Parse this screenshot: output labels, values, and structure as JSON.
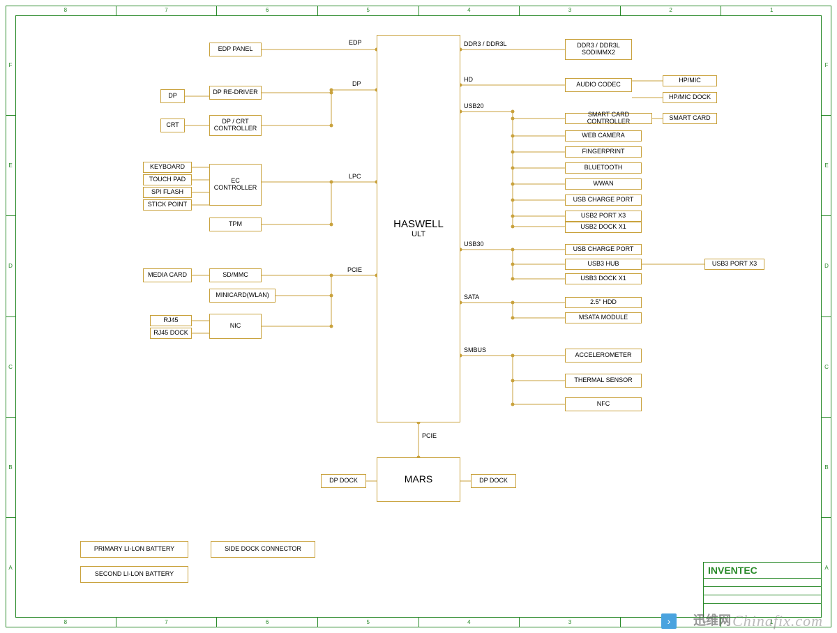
{
  "center": {
    "main": "HASWELL",
    "sub": "ULT",
    "south": "MARS"
  },
  "left_inputs": {
    "edp_panel": "EDP PANEL",
    "dp": "DP",
    "dp_redriver": "DP RE-DRIVER",
    "crt": "CRT",
    "dp_crt_ctrl": "DP / CRT\nCONTROLLER",
    "keyboard": "KEYBOARD",
    "touchpad": "TOUCH PAD",
    "spiflash": "SPI FLASH",
    "stickpoint": "STICK POINT",
    "ec": "EC\nCONTROLLER",
    "tpm": "TPM",
    "mediacard": "MEDIA CARD",
    "sdmmc": "SD/MMC",
    "minicard": "MINICARD(WLAN)",
    "rj45": "RJ45",
    "rj45dock": "RJ45 DOCK",
    "nic": "NIC"
  },
  "bus_labels": {
    "edp": "EDP",
    "dp": "DP",
    "lpc": "LPC",
    "pcie_left": "PCIE",
    "ddr": "DDR3 / DDR3L",
    "hd": "HD",
    "usb20": "USB20",
    "usb30": "USB30",
    "sata": "SATA",
    "smbus": "SMBUS",
    "pcie_down": "PCIE"
  },
  "right": {
    "ddr": "DDR3 / DDR3L\nSODIMMX2",
    "audio": "AUDIO CODEC",
    "hpmic": "HP/MIC",
    "hpmicdock": "HP/MIC DOCK",
    "smartctrl": "SMART CARD CONTROLLER",
    "smartcard": "SMART CARD",
    "webcam": "WEB CAMERA",
    "fingerprint": "FINGERPRINT",
    "bluetooth": "BLUETOOTH",
    "wwan": "WWAN",
    "usbcharge2": "USB CHARGE PORT",
    "usb2x3": "USB2 PORT X3",
    "usb2dock": "USB2 DOCK X1",
    "usbcharge3": "USB CHARGE PORT",
    "usb3hub": "USB3 HUB",
    "usb3dock": "USB3 DOCK X1",
    "usb3x3": "USB3 PORT X3",
    "hdd": "2.5\" HDD",
    "msata": "MSATA MODULE",
    "accel": "ACCELEROMETER",
    "thermal": "THERMAL SENSOR",
    "nfc": "NFC"
  },
  "south": {
    "dpdock_l": "DP DOCK",
    "dpdock_r": "DP DOCK"
  },
  "misc": {
    "primary_batt": "PRIMARY LI-LON BATTERY",
    "second_batt": "SECOND LI-LON BATTERY",
    "sidedock": "SIDE DOCK CONNECTOR"
  },
  "titleblock": {
    "company": "INVENTEC"
  },
  "ruler": {
    "cols": [
      "8",
      "7",
      "6",
      "5",
      "4",
      "3",
      "2",
      "1"
    ],
    "rows": [
      "F",
      "E",
      "D",
      "C",
      "B",
      "A"
    ]
  },
  "watermark": {
    "site": "Chinafix.com",
    "cn": "迅维网",
    "arrow": "›"
  }
}
